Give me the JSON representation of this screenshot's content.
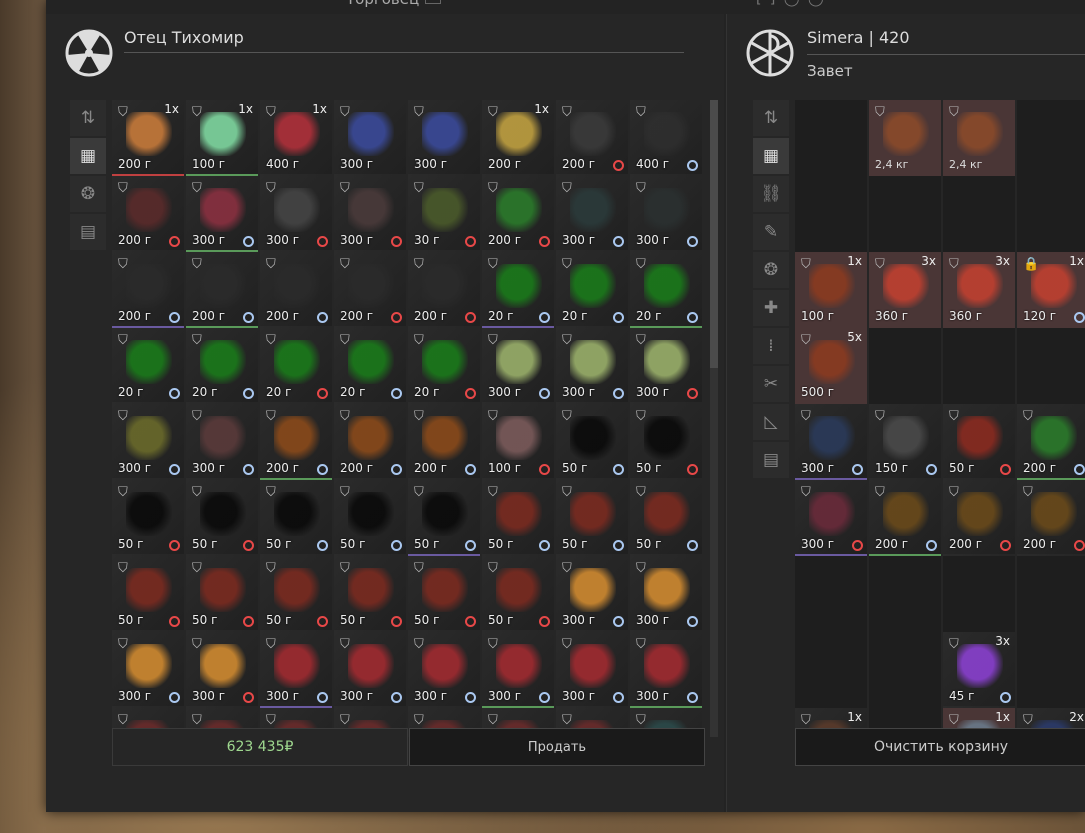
{
  "window": {
    "title": "Торговец"
  },
  "trader": {
    "name": "Отец Тихомир",
    "icon": "radiation-icon"
  },
  "player": {
    "name": "Simera | 420",
    "faction": "Завет",
    "icon": "faction-emblem-icon"
  },
  "left_sidebar": [
    {
      "icon": "sort-icon",
      "glyph": "⇅"
    },
    {
      "icon": "grid-icon",
      "glyph": "▦",
      "active": true
    },
    {
      "icon": "artifact-icon",
      "glyph": "❂"
    },
    {
      "icon": "archive-icon",
      "glyph": "▤"
    }
  ],
  "right_sidebar": [
    {
      "icon": "sort-icon",
      "glyph": "⇅"
    },
    {
      "icon": "grid-icon",
      "glyph": "▦",
      "active": true
    },
    {
      "icon": "link-icon",
      "glyph": "⛓"
    },
    {
      "icon": "weapon-icon",
      "glyph": "✎"
    },
    {
      "icon": "artifact-icon",
      "glyph": "❂"
    },
    {
      "icon": "medkit-icon",
      "glyph": "✚"
    },
    {
      "icon": "ammo-icon",
      "glyph": "⁞"
    },
    {
      "icon": "tools-icon",
      "glyph": "✂"
    },
    {
      "icon": "ruler-icon",
      "glyph": "◺"
    },
    {
      "icon": "archive-icon",
      "glyph": "▤"
    }
  ],
  "trader_items": [
    {
      "price": "200 г",
      "count": "1x",
      "color": "#c77a3a",
      "border": "#c04040"
    },
    {
      "price": "100 г",
      "count": "1x",
      "color": "#7fd8a0",
      "border": "#5a9a5a"
    },
    {
      "price": "400 г",
      "count": "1x",
      "color": "#b0303a",
      "border": ""
    },
    {
      "price": "300 г",
      "color": "#3a4a9a",
      "border": ""
    },
    {
      "price": "300 г",
      "color": "#3a4a9a",
      "border": ""
    },
    {
      "price": "200 г",
      "count": "1x",
      "color": "#c0a040",
      "border": ""
    },
    {
      "price": "200 г",
      "clock": "red",
      "color": "#3a3a3a",
      "border": ""
    },
    {
      "price": "400 г",
      "clock": "blue",
      "color": "#2e2e2e",
      "border": ""
    },
    {
      "price": "200 г",
      "clock": "red",
      "color": "#5a2a2a",
      "border": ""
    },
    {
      "price": "300 г",
      "clock": "blue",
      "color": "#8a3040",
      "border": "#5a9a5a"
    },
    {
      "price": "300 г",
      "clock": "red",
      "color": "#444",
      "border": ""
    },
    {
      "price": "300 г",
      "clock": "red",
      "color": "#4a3a3a",
      "border": ""
    },
    {
      "price": "30 г",
      "clock": "red",
      "color": "#4a5a2a",
      "border": ""
    },
    {
      "price": "200 г",
      "clock": "red",
      "color": "#2a7a2a",
      "border": ""
    },
    {
      "price": "300 г",
      "clock": "blue",
      "color": "#2a3a3a",
      "border": ""
    },
    {
      "price": "300 г",
      "clock": "blue",
      "color": "#2a3030",
      "border": ""
    },
    {
      "price": "200 г",
      "clock": "blue",
      "color": "#2a2a2a",
      "border": "#6a5aa0"
    },
    {
      "price": "200 г",
      "clock": "blue",
      "color": "#2a2a2a",
      "border": "#5a9a5a"
    },
    {
      "price": "200 г",
      "clock": "blue",
      "color": "#2a2a2a",
      "border": ""
    },
    {
      "price": "200 г",
      "clock": "red",
      "color": "#2a2a2a",
      "border": ""
    },
    {
      "price": "200 г",
      "clock": "red",
      "color": "#2a2a2a",
      "border": ""
    },
    {
      "price": "20 г",
      "clock": "blue",
      "color": "#1a7a1a",
      "border": "#6a5aa0"
    },
    {
      "price": "20 г",
      "clock": "blue",
      "color": "#1a7a1a",
      "border": ""
    },
    {
      "price": "20 г",
      "clock": "blue",
      "color": "#1a7a1a",
      "border": "#5a9a5a"
    },
    {
      "price": "20 г",
      "clock": "blue",
      "color": "#1a7a1a",
      "border": ""
    },
    {
      "price": "20 г",
      "clock": "blue",
      "color": "#1a7a1a",
      "border": ""
    },
    {
      "price": "20 г",
      "clock": "red",
      "color": "#1a7a1a",
      "border": ""
    },
    {
      "price": "20 г",
      "clock": "blue",
      "color": "#1a7a1a",
      "border": ""
    },
    {
      "price": "20 г",
      "clock": "red",
      "color": "#1a7a1a",
      "border": ""
    },
    {
      "price": "300 г",
      "clock": "blue",
      "color": "#9ab06a",
      "border": ""
    },
    {
      "price": "300 г",
      "clock": "blue",
      "color": "#9ab06a",
      "border": ""
    },
    {
      "price": "300 г",
      "clock": "red",
      "color": "#9ab06a",
      "border": ""
    },
    {
      "price": "300 г",
      "clock": "blue",
      "color": "#6a6a2a",
      "border": ""
    },
    {
      "price": "300 г",
      "clock": "blue",
      "color": "#5a3a3a",
      "border": ""
    },
    {
      "price": "200 г",
      "clock": "blue",
      "color": "#8a4a1a",
      "border": "#5a9a5a"
    },
    {
      "price": "200 г",
      "clock": "blue",
      "color": "#8a4a1a",
      "border": ""
    },
    {
      "price": "200 г",
      "clock": "blue",
      "color": "#8a4a1a",
      "border": ""
    },
    {
      "price": "100 г",
      "clock": "red",
      "color": "#7a5a5a",
      "border": ""
    },
    {
      "price": "50 г",
      "clock": "blue",
      "color": "#0a0a0a",
      "border": ""
    },
    {
      "price": "50 г",
      "clock": "red",
      "color": "#0a0a0a",
      "border": ""
    },
    {
      "price": "50 г",
      "clock": "red",
      "color": "#0a0a0a",
      "border": ""
    },
    {
      "price": "50 г",
      "clock": "red",
      "color": "#0a0a0a",
      "border": ""
    },
    {
      "price": "50 г",
      "clock": "blue",
      "color": "#0a0a0a",
      "border": ""
    },
    {
      "price": "50 г",
      "clock": "blue",
      "color": "#0a0a0a",
      "border": ""
    },
    {
      "price": "50 г",
      "clock": "blue",
      "color": "#0a0a0a",
      "border": "#6a5aa0"
    },
    {
      "price": "50 г",
      "clock": "blue",
      "color": "#7a2a20",
      "border": ""
    },
    {
      "price": "50 г",
      "clock": "blue",
      "color": "#7a2a20",
      "border": ""
    },
    {
      "price": "50 г",
      "clock": "blue",
      "color": "#7a2a20",
      "border": ""
    },
    {
      "price": "50 г",
      "clock": "red",
      "color": "#7a2a20",
      "border": ""
    },
    {
      "price": "50 г",
      "clock": "red",
      "color": "#7a2a20",
      "border": ""
    },
    {
      "price": "50 г",
      "clock": "red",
      "color": "#7a2a20",
      "border": ""
    },
    {
      "price": "50 г",
      "clock": "red",
      "color": "#7a2a20",
      "border": ""
    },
    {
      "price": "50 г",
      "clock": "red",
      "color": "#7a2a20",
      "border": ""
    },
    {
      "price": "50 г",
      "clock": "red",
      "color": "#7a2a20",
      "border": ""
    },
    {
      "price": "300 г",
      "clock": "blue",
      "color": "#d08a30",
      "border": ""
    },
    {
      "price": "300 г",
      "clock": "blue",
      "color": "#d08a30",
      "border": ""
    },
    {
      "price": "300 г",
      "clock": "blue",
      "color": "#d08a30",
      "border": ""
    },
    {
      "price": "300 г",
      "clock": "red",
      "color": "#d08a30",
      "border": ""
    },
    {
      "price": "300 г",
      "clock": "blue",
      "color": "#a02a30",
      "border": "#6a5aa0"
    },
    {
      "price": "300 г",
      "clock": "blue",
      "color": "#a02a30",
      "border": ""
    },
    {
      "price": "300 г",
      "clock": "blue",
      "color": "#a02a30",
      "border": ""
    },
    {
      "price": "300 г",
      "clock": "blue",
      "color": "#a02a30",
      "border": "#5a9a5a"
    },
    {
      "price": "300 г",
      "clock": "blue",
      "color": "#a02a30",
      "border": ""
    },
    {
      "price": "300 г",
      "clock": "blue",
      "color": "#a02a30",
      "border": "#5a9a5a"
    },
    {
      "color": "#6a2a2a"
    },
    {
      "color": "#6a2a2a"
    },
    {
      "color": "#6a2a2a"
    },
    {
      "color": "#6a2a2a"
    },
    {
      "color": "#6a2a2a"
    },
    {
      "color": "#6a2a2a"
    },
    {
      "color": "#6a2a2a"
    },
    {
      "color": "#2a4a4a"
    }
  ],
  "player_items": [
    {
      "empty": true
    },
    {
      "weight": "2,4 кг",
      "color": "#8a4a2a",
      "bg": "#4a3636"
    },
    {
      "weight": "2,4 кг",
      "color": "#8a4a2a",
      "bg": "#4a3636"
    },
    {
      "empty": true
    },
    {
      "empty": true
    },
    {
      "empty": true
    },
    {
      "empty": true
    },
    {
      "empty": true
    },
    {
      "price": "100 г",
      "count": "1x",
      "color": "#8a3a20",
      "bg": "#4a3636"
    },
    {
      "price": "360 г",
      "count": "3x",
      "color": "#c04030",
      "bg": "#4a3636"
    },
    {
      "price": "360 г",
      "count": "3x",
      "color": "#c04030",
      "bg": "#4a3636"
    },
    {
      "price": "120 г",
      "count": "1x",
      "clock": "blue",
      "color": "#c04030",
      "bg": "#4a3636",
      "lock": true
    },
    {
      "price": "500 г",
      "count": "5x",
      "color": "#8a3a20",
      "bg": "#4a3636"
    },
    {
      "empty": true
    },
    {
      "empty": true
    },
    {
      "empty": true
    },
    {
      "price": "300 г",
      "clock": "blue",
      "color": "#2a3a5a",
      "border": "#6a5aa0"
    },
    {
      "price": "150 г",
      "clock": "blue",
      "color": "#4a4a4a",
      "border": ""
    },
    {
      "price": "50 г",
      "clock": "red",
      "color": "#8a2a20",
      "border": ""
    },
    {
      "price": "200 г",
      "clock": "blue",
      "color": "#2a7a2a",
      "border": "#5a9a5a"
    },
    {
      "price": "300 г",
      "clock": "red",
      "color": "#6a2a3a",
      "border": "#6a5aa0"
    },
    {
      "price": "200 г",
      "clock": "blue",
      "color": "#6a4a1a",
      "border": "#5a9a5a"
    },
    {
      "price": "200 г",
      "clock": "red",
      "color": "#6a4a1a",
      "border": ""
    },
    {
      "price": "200 г",
      "clock": "red",
      "color": "#6a4a1a",
      "border": ""
    },
    {
      "empty": true
    },
    {
      "empty": true
    },
    {
      "empty": true
    },
    {
      "empty": true
    },
    {
      "empty": true
    },
    {
      "empty": true
    },
    {
      "price": "45 г",
      "count": "3x",
      "clock": "blue",
      "color": "#8a40d0",
      "border": ""
    },
    {
      "empty": true
    },
    {
      "count": "1x",
      "color": "#5a3a2a",
      "border": ""
    },
    {
      "empty": true
    },
    {
      "count": "1x",
      "color": "#6a7a8a",
      "bg": "#4a3636"
    },
    {
      "count": "2x",
      "color": "#2a3a6a",
      "border": ""
    }
  ],
  "footer": {
    "money": "623 435",
    "currency": "₽",
    "sell_label": "Продать",
    "clear_label": "Очистить корзину"
  }
}
